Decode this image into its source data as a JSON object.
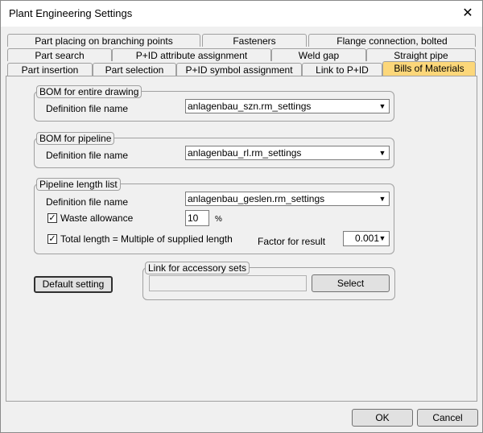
{
  "window": {
    "title": "Plant Engineering Settings"
  },
  "tabs": {
    "row1": [
      "Part placing on branching points",
      "Fasteners",
      "Flange connection, bolted"
    ],
    "row2": [
      "Part search",
      "P+ID attribute assignment",
      "Weld gap",
      "Straight pipe"
    ],
    "row3": [
      "Part insertion",
      "Part selection",
      "P+ID symbol assignment",
      "Link to P+ID",
      "Bills of Materials"
    ],
    "active": "Bills of Materials"
  },
  "bom_drawing": {
    "legend": "BOM for entire drawing",
    "label": "Definition file name",
    "value": "anlagenbau_szn.rm_settings"
  },
  "bom_pipeline": {
    "legend": "BOM for pipeline",
    "label": "Definition file name",
    "value": "anlagenbau_rl.rm_settings"
  },
  "pipeline_length": {
    "legend": "Pipeline length list",
    "label": "Definition file name",
    "value": "anlagenbau_geslen.rm_settings",
    "waste_label": "Waste allowance",
    "waste_checked": true,
    "waste_value": "10",
    "waste_unit": "%",
    "total_label": "Total length = Multiple of supplied length",
    "total_checked": true,
    "factor_label": "Factor for result",
    "factor_value": "0.001"
  },
  "default_button": "Default setting",
  "accessory": {
    "legend": "Link for accessory sets",
    "value": "",
    "select_button": "Select"
  },
  "footer": {
    "ok": "OK",
    "cancel": "Cancel"
  }
}
